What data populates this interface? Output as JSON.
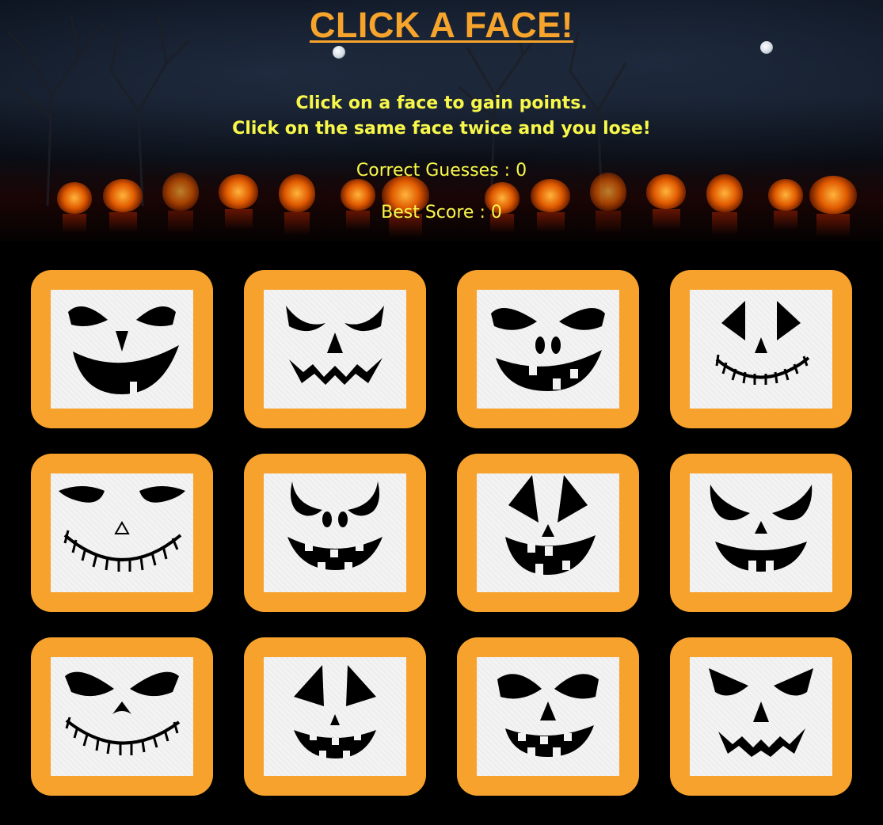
{
  "header": {
    "title": "CLICK A FACE!",
    "instruction_line1": "Click on a face to gain points.",
    "instruction_line2": "Click on the same face twice and you lose!",
    "correct_guesses_label": "Correct Guesses : ",
    "correct_guesses_value": "0",
    "best_score_label": "Best Score : ",
    "best_score_value": "0"
  },
  "cards": [
    {
      "icon": "angry-grin-pumpkin-face-icon"
    },
    {
      "icon": "zigzag-mouth-pumpkin-face-icon"
    },
    {
      "icon": "sly-grin-pumpkin-face-icon"
    },
    {
      "icon": "stitched-smile-pumpkin-face-icon"
    },
    {
      "icon": "wide-stitched-smile-pumpkin-face-icon"
    },
    {
      "icon": "fanged-smile-pumpkin-face-icon"
    },
    {
      "icon": "tall-triangle-eyes-pumpkin-face-icon"
    },
    {
      "icon": "toothy-grin-pumpkin-face-icon"
    },
    {
      "icon": "sly-stitched-smile-pumpkin-face-icon"
    },
    {
      "icon": "classic-triangle-pumpkin-face-icon"
    },
    {
      "icon": "menacing-grin-pumpkin-face-icon"
    },
    {
      "icon": "zigzag-fanged-pumpkin-face-icon"
    }
  ],
  "colors": {
    "card_orange": "#f7a22d",
    "title_orange": "#f7a42d",
    "text_yellow": "#f8f84a",
    "background": "#000000"
  }
}
